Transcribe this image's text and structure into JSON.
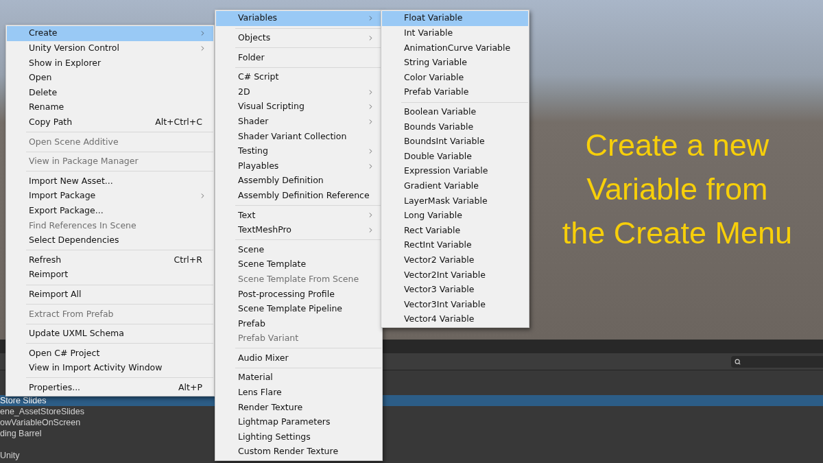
{
  "overlay_caption": {
    "lines": [
      "Create a new",
      "Variable from",
      "the Create Menu"
    ]
  },
  "hierarchy": {
    "rows": [
      {
        "kind": "item",
        "label": "Store Slides",
        "selected": true
      },
      {
        "kind": "item",
        "label": "ene_AssetStoreSlides",
        "selected": false
      },
      {
        "kind": "item",
        "label": "owVariableOnScreen",
        "selected": false
      },
      {
        "kind": "item",
        "label": "ding Barrel",
        "selected": false
      },
      {
        "kind": "blank"
      },
      {
        "kind": "item",
        "label": "Unity",
        "selected": false
      }
    ]
  },
  "menus": [
    {
      "items": [
        {
          "kind": "item",
          "label": "Create",
          "selected": true,
          "disabled": false,
          "submenu": true
        },
        {
          "kind": "item",
          "label": "Unity Version Control",
          "selected": false,
          "disabled": false,
          "submenu": true
        },
        {
          "kind": "item",
          "label": "Show in Explorer",
          "selected": false,
          "disabled": false,
          "submenu": false
        },
        {
          "kind": "item",
          "label": "Open",
          "selected": false,
          "disabled": false,
          "submenu": false
        },
        {
          "kind": "item",
          "label": "Delete",
          "selected": false,
          "disabled": false,
          "submenu": false
        },
        {
          "kind": "item",
          "label": "Rename",
          "selected": false,
          "disabled": false,
          "submenu": false
        },
        {
          "kind": "item",
          "label": "Copy Path",
          "selected": false,
          "disabled": false,
          "submenu": false,
          "shortcut": "Alt+Ctrl+C"
        },
        {
          "kind": "separator"
        },
        {
          "kind": "item",
          "label": "Open Scene Additive",
          "selected": false,
          "disabled": true,
          "submenu": false
        },
        {
          "kind": "separator"
        },
        {
          "kind": "item",
          "label": "View in Package Manager",
          "selected": false,
          "disabled": true,
          "submenu": false
        },
        {
          "kind": "separator"
        },
        {
          "kind": "item",
          "label": "Import New Asset...",
          "selected": false,
          "disabled": false,
          "submenu": false
        },
        {
          "kind": "item",
          "label": "Import Package",
          "selected": false,
          "disabled": false,
          "submenu": true
        },
        {
          "kind": "item",
          "label": "Export Package...",
          "selected": false,
          "disabled": false,
          "submenu": false
        },
        {
          "kind": "item",
          "label": "Find References In Scene",
          "selected": false,
          "disabled": true,
          "submenu": false
        },
        {
          "kind": "item",
          "label": "Select Dependencies",
          "selected": false,
          "disabled": false,
          "submenu": false
        },
        {
          "kind": "separator"
        },
        {
          "kind": "item",
          "label": "Refresh",
          "selected": false,
          "disabled": false,
          "submenu": false,
          "shortcut": "Ctrl+R"
        },
        {
          "kind": "item",
          "label": "Reimport",
          "selected": false,
          "disabled": false,
          "submenu": false
        },
        {
          "kind": "separator"
        },
        {
          "kind": "item",
          "label": "Reimport All",
          "selected": false,
          "disabled": false,
          "submenu": false
        },
        {
          "kind": "separator"
        },
        {
          "kind": "item",
          "label": "Extract From Prefab",
          "selected": false,
          "disabled": true,
          "submenu": false
        },
        {
          "kind": "separator"
        },
        {
          "kind": "item",
          "label": "Update UXML Schema",
          "selected": false,
          "disabled": false,
          "submenu": false
        },
        {
          "kind": "separator"
        },
        {
          "kind": "item",
          "label": "Open C# Project",
          "selected": false,
          "disabled": false,
          "submenu": false
        },
        {
          "kind": "item",
          "label": "View in Import Activity Window",
          "selected": false,
          "disabled": false,
          "submenu": false
        },
        {
          "kind": "separator"
        },
        {
          "kind": "item",
          "label": "Properties...",
          "selected": false,
          "disabled": false,
          "submenu": false,
          "shortcut": "Alt+P"
        }
      ]
    },
    {
      "items": [
        {
          "kind": "item",
          "label": "Variables",
          "selected": true,
          "disabled": false,
          "submenu": true
        },
        {
          "kind": "separator"
        },
        {
          "kind": "item",
          "label": "Objects",
          "selected": false,
          "disabled": false,
          "submenu": true
        },
        {
          "kind": "separator"
        },
        {
          "kind": "item",
          "label": "Folder",
          "selected": false,
          "disabled": false,
          "submenu": false
        },
        {
          "kind": "separator"
        },
        {
          "kind": "item",
          "label": "C# Script",
          "selected": false,
          "disabled": false,
          "submenu": false
        },
        {
          "kind": "item",
          "label": "2D",
          "selected": false,
          "disabled": false,
          "submenu": true
        },
        {
          "kind": "item",
          "label": "Visual Scripting",
          "selected": false,
          "disabled": false,
          "submenu": true
        },
        {
          "kind": "item",
          "label": "Shader",
          "selected": false,
          "disabled": false,
          "submenu": true
        },
        {
          "kind": "item",
          "label": "Shader Variant Collection",
          "selected": false,
          "disabled": false,
          "submenu": false
        },
        {
          "kind": "item",
          "label": "Testing",
          "selected": false,
          "disabled": false,
          "submenu": true
        },
        {
          "kind": "item",
          "label": "Playables",
          "selected": false,
          "disabled": false,
          "submenu": true
        },
        {
          "kind": "item",
          "label": "Assembly Definition",
          "selected": false,
          "disabled": false,
          "submenu": false
        },
        {
          "kind": "item",
          "label": "Assembly Definition Reference",
          "selected": false,
          "disabled": false,
          "submenu": false
        },
        {
          "kind": "separator"
        },
        {
          "kind": "item",
          "label": "Text",
          "selected": false,
          "disabled": false,
          "submenu": true
        },
        {
          "kind": "item",
          "label": "TextMeshPro",
          "selected": false,
          "disabled": false,
          "submenu": true
        },
        {
          "kind": "separator"
        },
        {
          "kind": "item",
          "label": "Scene",
          "selected": false,
          "disabled": false,
          "submenu": false
        },
        {
          "kind": "item",
          "label": "Scene Template",
          "selected": false,
          "disabled": false,
          "submenu": false
        },
        {
          "kind": "item",
          "label": "Scene Template From Scene",
          "selected": false,
          "disabled": true,
          "submenu": false
        },
        {
          "kind": "item",
          "label": "Post-processing Profile",
          "selected": false,
          "disabled": false,
          "submenu": false
        },
        {
          "kind": "item",
          "label": "Scene Template Pipeline",
          "selected": false,
          "disabled": false,
          "submenu": false
        },
        {
          "kind": "item",
          "label": "Prefab",
          "selected": false,
          "disabled": false,
          "submenu": false
        },
        {
          "kind": "item",
          "label": "Prefab Variant",
          "selected": false,
          "disabled": true,
          "submenu": false
        },
        {
          "kind": "separator"
        },
        {
          "kind": "item",
          "label": "Audio Mixer",
          "selected": false,
          "disabled": false,
          "submenu": false
        },
        {
          "kind": "separator"
        },
        {
          "kind": "item",
          "label": "Material",
          "selected": false,
          "disabled": false,
          "submenu": false
        },
        {
          "kind": "item",
          "label": "Lens Flare",
          "selected": false,
          "disabled": false,
          "submenu": false
        },
        {
          "kind": "item",
          "label": "Render Texture",
          "selected": false,
          "disabled": false,
          "submenu": false
        },
        {
          "kind": "item",
          "label": "Lightmap Parameters",
          "selected": false,
          "disabled": false,
          "submenu": false
        },
        {
          "kind": "item",
          "label": "Lighting Settings",
          "selected": false,
          "disabled": false,
          "submenu": false
        },
        {
          "kind": "item",
          "label": "Custom Render Texture",
          "selected": false,
          "disabled": false,
          "submenu": false
        }
      ]
    },
    {
      "items": [
        {
          "kind": "item",
          "label": "Float Variable",
          "selected": true,
          "disabled": false,
          "submenu": false
        },
        {
          "kind": "item",
          "label": "Int Variable",
          "selected": false,
          "disabled": false,
          "submenu": false
        },
        {
          "kind": "item",
          "label": "AnimationCurve Variable",
          "selected": false,
          "disabled": false,
          "submenu": false
        },
        {
          "kind": "item",
          "label": "String Variable",
          "selected": false,
          "disabled": false,
          "submenu": false
        },
        {
          "kind": "item",
          "label": "Color Variable",
          "selected": false,
          "disabled": false,
          "submenu": false
        },
        {
          "kind": "item",
          "label": "Prefab Variable",
          "selected": false,
          "disabled": false,
          "submenu": false
        },
        {
          "kind": "separator"
        },
        {
          "kind": "item",
          "label": "Boolean Variable",
          "selected": false,
          "disabled": false,
          "submenu": false
        },
        {
          "kind": "item",
          "label": "Bounds Variable",
          "selected": false,
          "disabled": false,
          "submenu": false
        },
        {
          "kind": "item",
          "label": "BoundsInt Variable",
          "selected": false,
          "disabled": false,
          "submenu": false
        },
        {
          "kind": "item",
          "label": "Double Variable",
          "selected": false,
          "disabled": false,
          "submenu": false
        },
        {
          "kind": "item",
          "label": "Expression Variable",
          "selected": false,
          "disabled": false,
          "submenu": false
        },
        {
          "kind": "item",
          "label": "Gradient Variable",
          "selected": false,
          "disabled": false,
          "submenu": false
        },
        {
          "kind": "item",
          "label": "LayerMask Variable",
          "selected": false,
          "disabled": false,
          "submenu": false
        },
        {
          "kind": "item",
          "label": "Long Variable",
          "selected": false,
          "disabled": false,
          "submenu": false
        },
        {
          "kind": "item",
          "label": "Rect Variable",
          "selected": false,
          "disabled": false,
          "submenu": false
        },
        {
          "kind": "item",
          "label": "RectInt Variable",
          "selected": false,
          "disabled": false,
          "submenu": false
        },
        {
          "kind": "item",
          "label": "Vector2 Variable",
          "selected": false,
          "disabled": false,
          "submenu": false
        },
        {
          "kind": "item",
          "label": "Vector2Int Variable",
          "selected": false,
          "disabled": false,
          "submenu": false
        },
        {
          "kind": "item",
          "label": "Vector3 Variable",
          "selected": false,
          "disabled": false,
          "submenu": false
        },
        {
          "kind": "item",
          "label": "Vector3Int Variable",
          "selected": false,
          "disabled": false,
          "submenu": false
        },
        {
          "kind": "item",
          "label": "Vector4 Variable",
          "selected": false,
          "disabled": false,
          "submenu": false
        }
      ]
    }
  ]
}
